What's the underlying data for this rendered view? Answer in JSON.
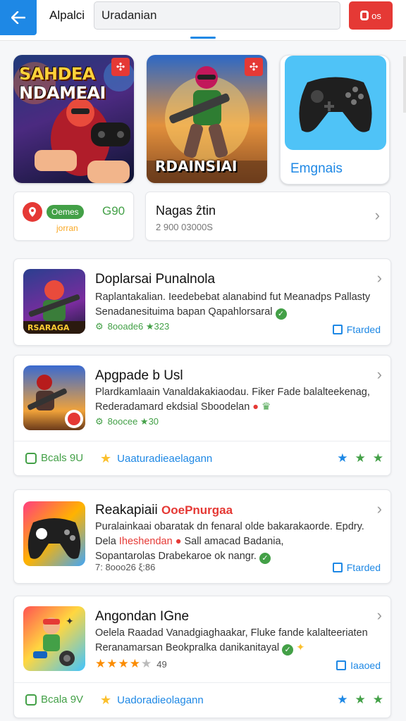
{
  "header": {
    "title": "Alpalci",
    "search_value": "Uradanian",
    "button_label": "os"
  },
  "featured": [
    {
      "title_line1": "SAHDEA",
      "title_line2": "NDAMEAI"
    },
    {
      "title": "RDAINSIAI"
    },
    {
      "label": "Emgnais"
    }
  ],
  "info_cards": {
    "left": {
      "pill": "Oemes",
      "number": "G90",
      "sub": "jorran"
    },
    "right": {
      "title": "Nagas ẑtin",
      "sub": "2 900 03000S"
    }
  },
  "list": [
    {
      "title": "Doplarsai Punalnola",
      "desc_line1": "Raplantakalian. Ieedebebat alanabind fut Meanadps Pallasty",
      "desc_line2": "Senadanesituima bapan Qapahlorsaral",
      "meta": "8ooade6 ★323",
      "action": "Ftarded"
    },
    {
      "title": "Apgpade b Usl",
      "desc_line1": "Plardkamlaain Vanaldakakiaodau. Fiker Fade balalteekenag,",
      "desc_line2": "Rederadamard ekdsial Sboodelan",
      "meta": "8oocee ★30",
      "footer_left": "Bcals 9U",
      "footer_mid": "Uaaturadieaelagann"
    },
    {
      "title": "Reakapiaii",
      "title_tag": "OoePnurgaa",
      "desc_line1": "Puralainkaai obaratak dn fenaral olde bakarakaorde. Epdry.",
      "desc_line2_a": "Dela",
      "desc_line2_b": "Iheshendan",
      "desc_line2_c": "Sall amacad Badania,",
      "desc_line3": "Sopantarolas Drabekaroe ok nangr.",
      "meta": "7: 8ooo26 ξ:86",
      "action": "Ftarded"
    },
    {
      "title": "Angondan IGne",
      "desc_line1": "Oelela Raadad Vanadgiaghaakar, Fluke fande kalalteeriaten",
      "desc_line2": "Reranamarsan Beokpralka danikanitayal",
      "meta": "49",
      "action": "Iaaoed",
      "footer_left": "Bcala 9V",
      "footer_mid": "Uadoradieolagann"
    }
  ],
  "colors": {
    "primary": "#1e88e5",
    "accent_red": "#e53935",
    "green": "#43a047",
    "yellow": "#fbc02d"
  }
}
